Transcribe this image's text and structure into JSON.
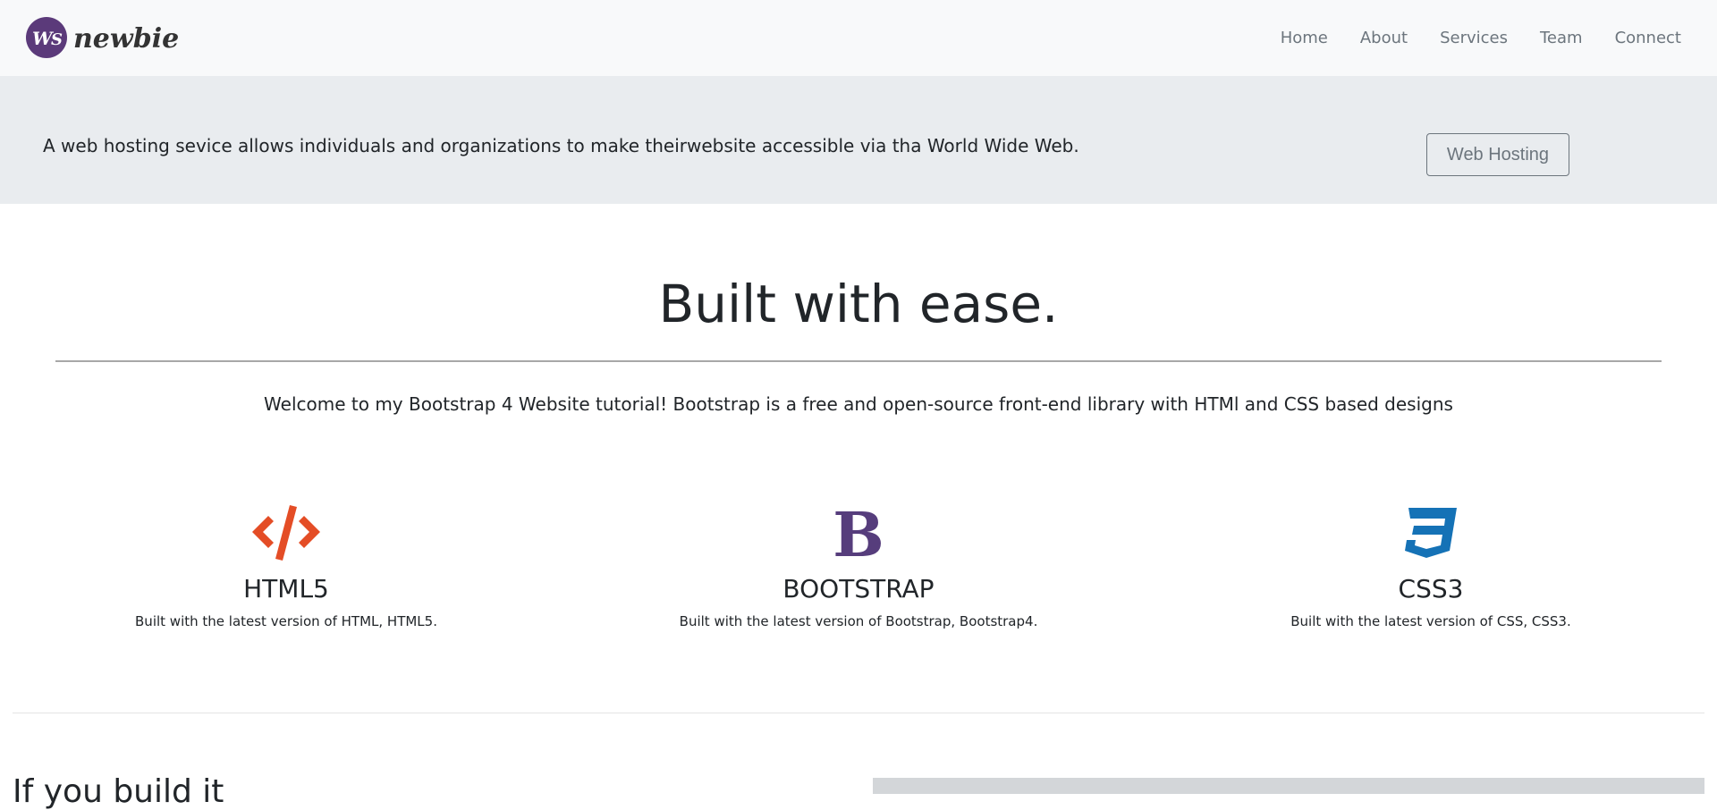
{
  "brand": {
    "logo_text": "newbie",
    "logo_monogram": "WS"
  },
  "nav": {
    "items": [
      {
        "label": "Home"
      },
      {
        "label": "About"
      },
      {
        "label": "Services"
      },
      {
        "label": "Team"
      },
      {
        "label": "Connect"
      }
    ]
  },
  "banner": {
    "text": "A web hosting sevice allows individuals and organizations to make theirwebsite accessible via tha World Wide Web.",
    "button_label": "Web Hosting"
  },
  "intro": {
    "heading": "Built with ease.",
    "lead": "Welcome to my Bootstrap 4 Website tutorial! Bootstrap is a free and open-source front-end library with HTMl and CSS based designs"
  },
  "features": [
    {
      "icon": "html5-code-icon",
      "title": "HTML5",
      "desc": "Built with the latest version of HTML, HTML5.",
      "color": "#e44d26"
    },
    {
      "icon": "bootstrap-icon",
      "title": "BOOTSTRAP",
      "desc": "Built with the latest version of Bootstrap, Bootstrap4.",
      "color": "#563d7c"
    },
    {
      "icon": "css3-icon",
      "title": "CSS3",
      "desc": "Built with the latest version of CSS, CSS3.",
      "color": "#1572b6"
    }
  ],
  "next_section": {
    "heading": "If you build it"
  }
}
